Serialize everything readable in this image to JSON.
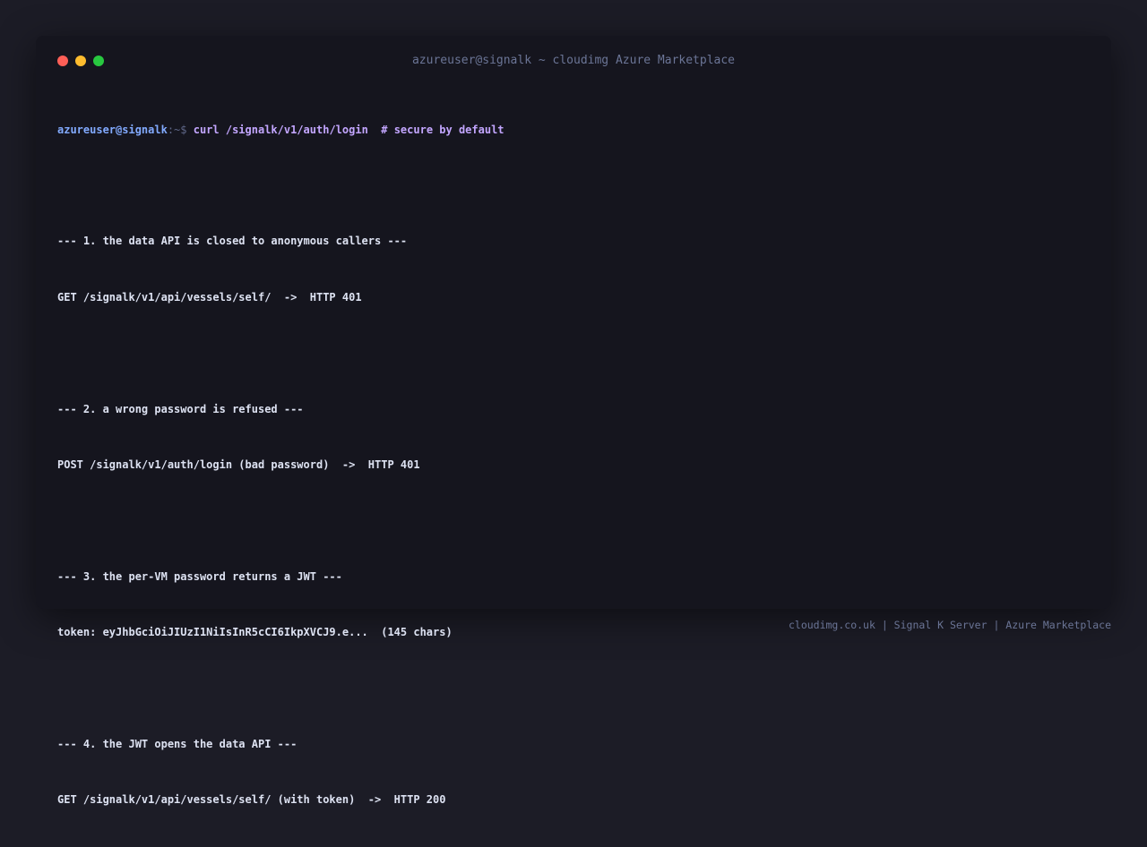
{
  "window": {
    "title": "azureuser@signalk ~ cloudimg Azure Marketplace"
  },
  "terminal": {
    "prompt_user": "azureuser@signalk",
    "prompt_path": ":~$ ",
    "command": "curl /signalk/v1/auth/login  # secure by default",
    "lines": [
      "--- 1. the data API is closed to anonymous callers ---",
      "GET /signalk/v1/api/vessels/self/  ->  HTTP 401",
      "",
      "--- 2. a wrong password is refused ---",
      "POST /signalk/v1/auth/login (bad password)  ->  HTTP 401",
      "",
      "--- 3. the per-VM password returns a JWT ---",
      "token: eyJhbGciOiJIUzI1NiIsInR5cCI6IkpXVCJ9.e...  (145 chars)",
      "",
      "--- 4. the JWT opens the data API ---",
      "GET /signalk/v1/api/vessels/self/ (with token)  ->  HTTP 200"
    ]
  },
  "footer": {
    "text": "cloudimg.co.uk | Signal K Server | Azure Marketplace"
  },
  "colors": {
    "background": "#1c1c26",
    "window": "#15151e",
    "prompt_user": "#82aaff",
    "command": "#c3a6ff",
    "output": "#dde2f2",
    "muted": "#6b7596",
    "close": "#ff5f57",
    "minimize": "#febc2e",
    "maximize": "#28c840"
  }
}
